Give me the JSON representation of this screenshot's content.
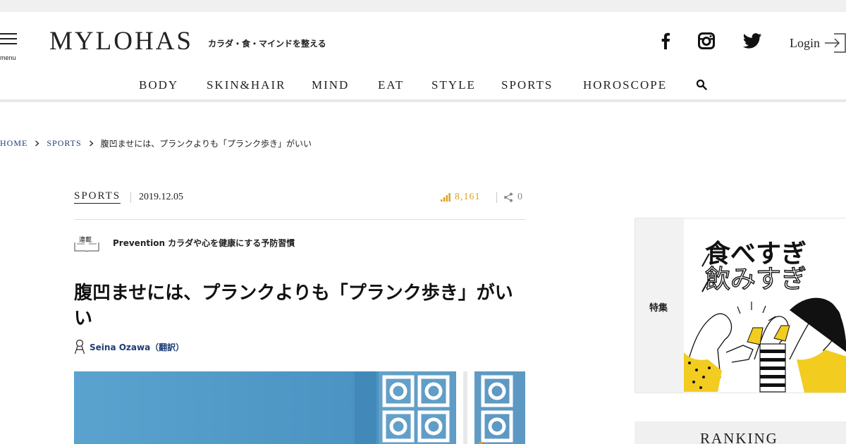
{
  "header": {
    "menu_label": "menu",
    "logo": "MYLOHAS",
    "tagline": "カラダ・食・マインドを整える",
    "social": [
      "facebook-icon",
      "instagram-icon",
      "twitter-icon"
    ],
    "login_label": "Login"
  },
  "nav": {
    "items": [
      "BODY",
      "SKIN&HAIR",
      "MIND",
      "EAT",
      "STYLE",
      "SPORTS",
      "HOROSCOPE"
    ],
    "search_icon": "search-icon"
  },
  "breadcrumb": {
    "home": "HOME",
    "category": "SPORTS",
    "current": "腹凹ませには、プランクよりも「プランク歩き」がいい"
  },
  "article": {
    "category": "SPORTS",
    "date": "2019.12.05",
    "views": "8,161",
    "shares": "0",
    "series_badge": "連載",
    "series_title": "Prevention カラダや心を健康にする予防習慣",
    "title": "腹凹ませには、プランクよりも「プランク歩き」がいい",
    "author": "Seina Ozawa（翻訳）"
  },
  "sidebar": {
    "feature_label": "特集",
    "feature_banner_line1": "食べすぎ",
    "feature_banner_line2": "飲みすぎ",
    "ranking_title": "RANKING"
  },
  "colors": {
    "accent_gold": "#e0a21c",
    "link_navy": "#1d3d74",
    "hero_blue": "#4f98c5",
    "banner_yellow": "#f2cc1f"
  }
}
